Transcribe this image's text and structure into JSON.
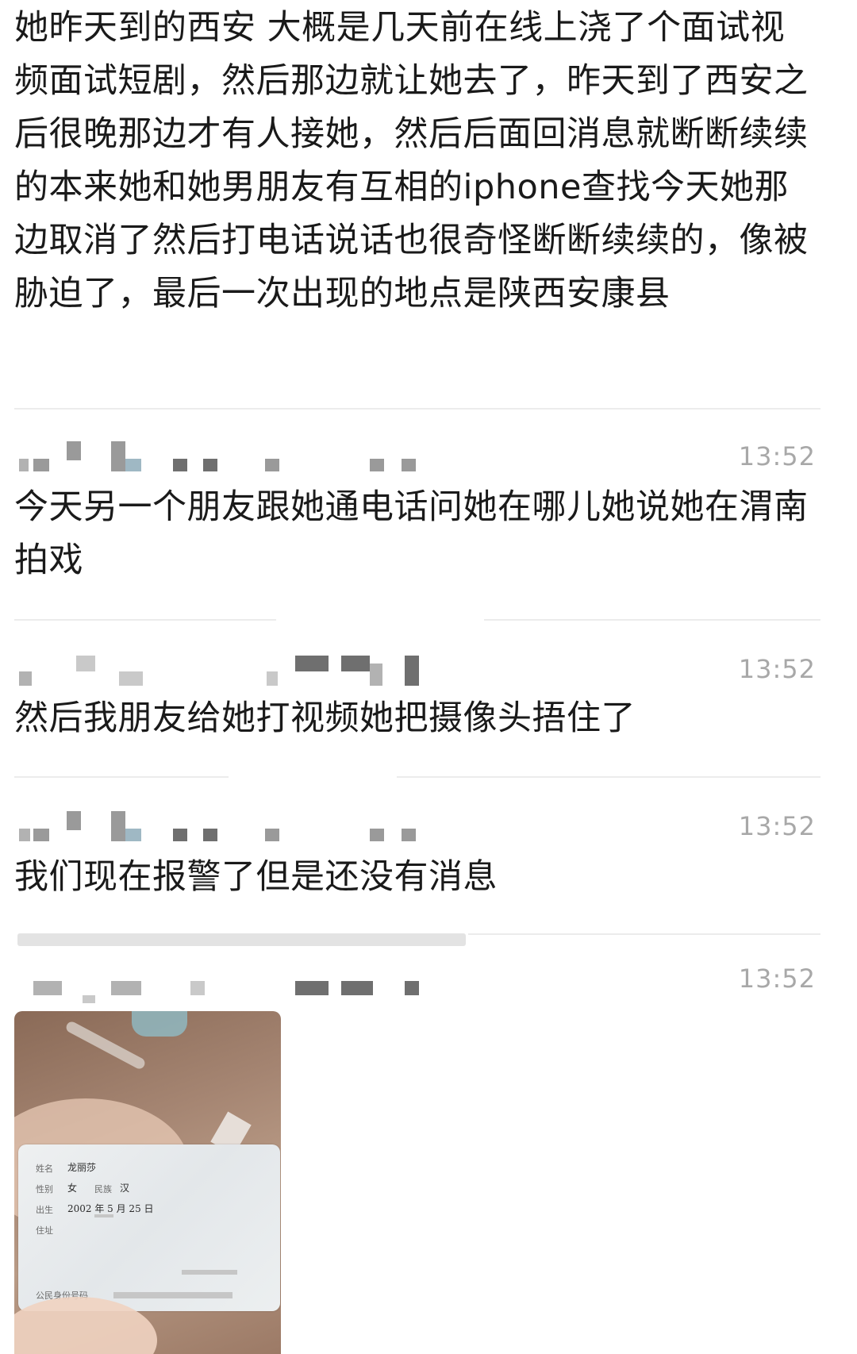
{
  "messages": [
    {
      "text": "她昨天到的西安 大概是几天前在线上浇了个面试视频面试短剧，然后那边就让她去了，昨天到了西安之后很晚那边才有人接她，然后后面回消息就断断续续的本来她和她男朋友有互相的iphone查找今天她那边取消了然后打电话说话也很奇怪断断续续的，像被胁迫了，最后一次出现的地点是陕西安康县"
    },
    {
      "time": "13:52",
      "text": "今天另一个朋友跟她通电话问她在哪儿她说她在渭南拍戏"
    },
    {
      "time": "13:52",
      "text": "然后我朋友给她打视频她把摄像头捂住了"
    },
    {
      "time": "13:52",
      "text": "我们现在报警了但是还没有消息"
    },
    {
      "time": "13:52"
    }
  ],
  "id_card": {
    "name_label": "姓名",
    "name": "龙丽莎",
    "sex_label": "性别",
    "sex": "女",
    "ethnicity_label": "民族",
    "ethnicity": "汉",
    "birth_label": "出生",
    "birth": "2002 年 5 月 25 日",
    "address_label": "住址",
    "id_label": "公民身份号码"
  }
}
